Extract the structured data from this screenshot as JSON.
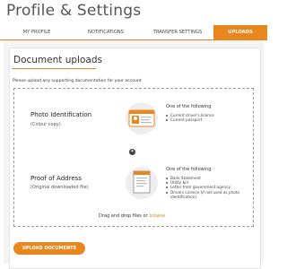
{
  "header": {
    "title": "Profile & Settings"
  },
  "tabs": [
    {
      "label": "MY PROFILE"
    },
    {
      "label": "NOTIFICATIONS"
    },
    {
      "label": "TRANSFER SETTINGS"
    },
    {
      "label": "UPLOADS",
      "active": true
    }
  ],
  "uploads": {
    "title": "Document uploads",
    "intro": "Please upload any supporting documentation for your account",
    "photo": {
      "title": "Photo Identification",
      "subtitle": "(Colour copy)",
      "one_of": "One of the following",
      "items": [
        "Current driver's licence",
        "Current passport"
      ]
    },
    "address": {
      "title": "Proof of Address",
      "subtitle": "(Original downloaded file)",
      "one_of": "One of the following",
      "items": [
        "Bank Statement",
        "Utility bill",
        "Letter from government agency",
        "Drivers Licence (if not used as photo identification)"
      ]
    },
    "drop_text": "Drag and drop files or",
    "browse_label": "browse",
    "upload_button": "UPLOAD DOCUMENTS"
  },
  "colors": {
    "accent": "#e8871e"
  }
}
